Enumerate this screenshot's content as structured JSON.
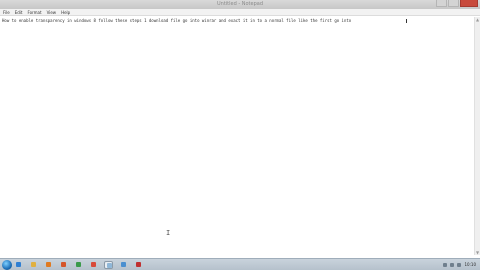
{
  "window": {
    "title": "Untitled - Notepad"
  },
  "menu": [
    {
      "label": "File"
    },
    {
      "label": "Edit"
    },
    {
      "label": "Format"
    },
    {
      "label": "View"
    },
    {
      "label": "Help"
    }
  ],
  "editor": {
    "text": "How to enable transparency in windows 8 follow these steps 1 download file go into winrar and exact it in to a normal file like the first go into"
  },
  "taskbar": {
    "clock": "10:10",
    "icons": [
      {
        "name": "ie-icon",
        "color": "#2f7fd3"
      },
      {
        "name": "explorer-icon",
        "color": "#e0b040"
      },
      {
        "name": "media-icon",
        "color": "#e07a20"
      },
      {
        "name": "firefox-icon",
        "color": "#d5552a"
      },
      {
        "name": "app-icon",
        "color": "#3a9a4a"
      },
      {
        "name": "chrome-icon",
        "color": "#d84a3a"
      },
      {
        "name": "notepad-icon",
        "color": "#8fb7d8"
      },
      {
        "name": "paint-icon",
        "color": "#4a8fd0"
      },
      {
        "name": "recorder-icon",
        "color": "#c03030"
      }
    ]
  }
}
